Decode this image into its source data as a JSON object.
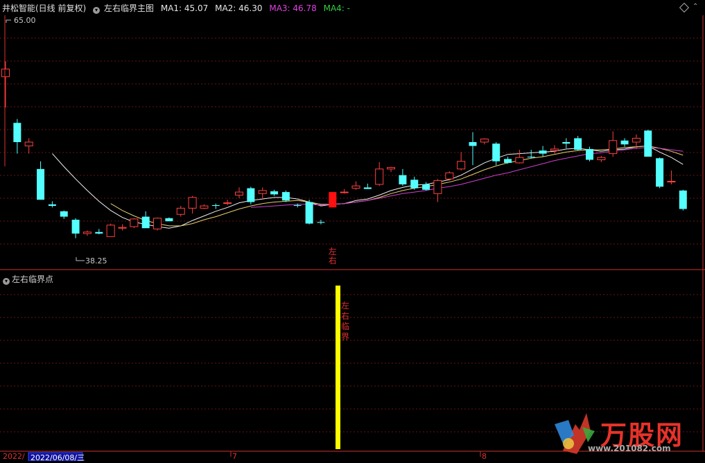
{
  "header": {
    "stock_name": "井松智能(日线 前复权)",
    "indicator_name": "左右临界主图",
    "ma1": "MA1: 45.07",
    "ma2": "MA2: 46.30",
    "ma3": "MA3: 46.78",
    "ma4": "MA4: -",
    "colors": {
      "ma1": "#e6e6e6",
      "ma2": "#e6e6e6",
      "ma3": "#e040e0",
      "ma4": "#30d040"
    }
  },
  "price_labels": {
    "high": "65.00",
    "low": "38.25"
  },
  "signal_label_main": "左右",
  "sub_panel": {
    "title": "左右临界点",
    "signal_label": "左右临界"
  },
  "date_axis": {
    "year_label": "2022/",
    "cursor_date": "2022/06/08/三",
    "month_7": "7",
    "month_8": "8"
  },
  "watermark": {
    "logo_text": "万股网",
    "url": "www.201082.com"
  },
  "chart_data": {
    "type": "candlestick",
    "price_range": [
      35,
      68
    ],
    "candles": [
      [
        60,
        62,
        56,
        61
      ],
      [
        54,
        54.5,
        50,
        51.5
      ],
      [
        51,
        52,
        50,
        51.5
      ],
      [
        48,
        49,
        44,
        44
      ],
      [
        43.4,
        43.8,
        43.0,
        43.2
      ],
      [
        42.5,
        42.6,
        41.5,
        41.8
      ],
      [
        41.4,
        41.6,
        39.0,
        39.6
      ],
      [
        39.6,
        40.0,
        39.3,
        39.8
      ],
      [
        39.8,
        40.2,
        39.5,
        39.6
      ],
      [
        39.2,
        40.9,
        39.2,
        40.7
      ],
      [
        40.3,
        40.8,
        40.0,
        40.4
      ],
      [
        40.5,
        41.6,
        40.3,
        41.5
      ],
      [
        41.8,
        42.5,
        40.8,
        40.3
      ],
      [
        40.2,
        41.7,
        40.0,
        41.6
      ],
      [
        41.6,
        41.7,
        41.2,
        41.2
      ],
      [
        42.1,
        43.2,
        41.8,
        42.9
      ],
      [
        42.9,
        44.5,
        42.2,
        44.3
      ],
      [
        42.9,
        43.4,
        42.8,
        43.2
      ],
      [
        43.3,
        43.5,
        42.8,
        43.2
      ],
      [
        43.6,
        44.0,
        43.3,
        43.6
      ],
      [
        44.6,
        45.6,
        44.2,
        45.0
      ],
      [
        45.5,
        45.7,
        43.4,
        43.7
      ],
      [
        44.8,
        45.6,
        44.1,
        45.2
      ],
      [
        45.1,
        45.3,
        44.5,
        44.7
      ],
      [
        45.0,
        45.2,
        43.7,
        43.9
      ],
      [
        43.3,
        43.5,
        43.0,
        43.2
      ],
      [
        43.7,
        44.0,
        40.8,
        40.9
      ],
      [
        41.1,
        41.4,
        40.8,
        41.0
      ],
      [
        43.0,
        45.0,
        43.0,
        45.0
      ],
      [
        45.0,
        45.4,
        44.8,
        45.0
      ],
      [
        45.5,
        46.4,
        45.3,
        45.8
      ],
      [
        45.6,
        46.1,
        45.4,
        45.4
      ],
      [
        46.0,
        48.9,
        45.8,
        48.0
      ],
      [
        48.0,
        48.3,
        47.6,
        48.2
      ],
      [
        47.2,
        48.0,
        45.8,
        46.0
      ],
      [
        46.6,
        47.0,
        45.3,
        45.5
      ],
      [
        46.0,
        46.3,
        45.2,
        45.3
      ],
      [
        44.8,
        46.7,
        43.7,
        46.5
      ],
      [
        46.7,
        47.7,
        46.5,
        47.5
      ],
      [
        48.0,
        50.2,
        47.8,
        49.0
      ],
      [
        51.5,
        52.8,
        48.5,
        51.0
      ],
      [
        51.5,
        52.0,
        51.2,
        51.9
      ],
      [
        51.3,
        51.5,
        48.5,
        49.0
      ],
      [
        49.3,
        49.6,
        48.7,
        48.8
      ],
      [
        48.8,
        50.5,
        48.7,
        49.5
      ],
      [
        49.6,
        50.5,
        49.4,
        49.5
      ],
      [
        50.4,
        51.0,
        49.6,
        50.0
      ],
      [
        50.4,
        51.1,
        50.0,
        50.6
      ],
      [
        51.5,
        52.0,
        50.7,
        51.3
      ],
      [
        52.0,
        52.3,
        50.4,
        50.5
      ],
      [
        50.6,
        50.9,
        49.0,
        49.2
      ],
      [
        49.2,
        49.7,
        48.9,
        49.5
      ],
      [
        50.0,
        52.9,
        49.6,
        51.7
      ],
      [
        51.7,
        52.0,
        50.9,
        51.2
      ],
      [
        51.5,
        52.5,
        50.6,
        52.0
      ],
      [
        53.0,
        53.1,
        49.6,
        49.6
      ],
      [
        49.4,
        49.5,
        45.5,
        45.7
      ],
      [
        46.4,
        47.8,
        46.0,
        46.4
      ],
      [
        45.2,
        45.3,
        42.6,
        42.8
      ]
    ],
    "ma1": [
      [
        4,
        50
      ],
      [
        5,
        48.3
      ],
      [
        6,
        46.7
      ],
      [
        7,
        45.2
      ],
      [
        8,
        43.8
      ],
      [
        9,
        42.6
      ],
      [
        10,
        41.7
      ],
      [
        11,
        41.1
      ],
      [
        12,
        40.8
      ],
      [
        13,
        40.5
      ],
      [
        14,
        40.3
      ],
      [
        15,
        40.6
      ],
      [
        16,
        41.3
      ],
      [
        17,
        41.9
      ],
      [
        18,
        42.5
      ],
      [
        19,
        43.0
      ],
      [
        20,
        43.6
      ],
      [
        21,
        43.9
      ],
      [
        22,
        44.1
      ],
      [
        23,
        44.3
      ],
      [
        24,
        44.3
      ],
      [
        25,
        44.1
      ],
      [
        26,
        43.7
      ],
      [
        27,
        43.2
      ],
      [
        28,
        43.4
      ],
      [
        29,
        43.5
      ],
      [
        30,
        43.9
      ],
      [
        31,
        44.1
      ],
      [
        32,
        44.6
      ],
      [
        33,
        45.2
      ],
      [
        34,
        45.6
      ],
      [
        35,
        45.9
      ],
      [
        36,
        46.0
      ],
      [
        37,
        46.3
      ],
      [
        38,
        46.6
      ],
      [
        39,
        47.2
      ],
      [
        40,
        48.0
      ],
      [
        41,
        48.8
      ],
      [
        42,
        49.4
      ],
      [
        43,
        49.9
      ],
      [
        44,
        50.0
      ],
      [
        45,
        50.1
      ],
      [
        46,
        50.2
      ],
      [
        47,
        50.3
      ],
      [
        48,
        50.6
      ],
      [
        49,
        50.7
      ],
      [
        50,
        50.5
      ],
      [
        51,
        50.3
      ],
      [
        52,
        50.5
      ],
      [
        53,
        50.6
      ],
      [
        54,
        50.9
      ],
      [
        55,
        51.0
      ],
      [
        56,
        50.2
      ],
      [
        57,
        49.5
      ],
      [
        58,
        48.6
      ]
    ],
    "ma2": [
      [
        9,
        43.5
      ],
      [
        10,
        42.6
      ],
      [
        11,
        41.9
      ],
      [
        12,
        41.3
      ],
      [
        13,
        40.9
      ],
      [
        14,
        40.6
      ],
      [
        15,
        40.6
      ],
      [
        16,
        40.9
      ],
      [
        17,
        41.4
      ],
      [
        18,
        41.8
      ],
      [
        19,
        42.3
      ],
      [
        20,
        42.8
      ],
      [
        21,
        43.2
      ],
      [
        22,
        43.5
      ],
      [
        23,
        43.7
      ],
      [
        24,
        43.8
      ],
      [
        25,
        43.9
      ],
      [
        26,
        43.7
      ],
      [
        27,
        43.4
      ],
      [
        28,
        43.4
      ],
      [
        29,
        43.5
      ],
      [
        30,
        43.7
      ],
      [
        31,
        43.9
      ],
      [
        32,
        44.3
      ],
      [
        33,
        44.8
      ],
      [
        34,
        45.2
      ],
      [
        35,
        45.5
      ],
      [
        36,
        45.7
      ],
      [
        37,
        46.0
      ],
      [
        38,
        46.3
      ],
      [
        39,
        46.7
      ],
      [
        40,
        47.3
      ],
      [
        41,
        47.9
      ],
      [
        42,
        48.4
      ],
      [
        43,
        48.8
      ],
      [
        44,
        49.1
      ],
      [
        45,
        49.4
      ],
      [
        46,
        49.6
      ],
      [
        47,
        49.9
      ],
      [
        48,
        50.2
      ],
      [
        49,
        50.4
      ],
      [
        50,
        50.5
      ],
      [
        51,
        50.5
      ],
      [
        52,
        50.6
      ],
      [
        53,
        50.8
      ],
      [
        54,
        50.9
      ],
      [
        55,
        51.0
      ],
      [
        56,
        50.7
      ],
      [
        57,
        50.3
      ],
      [
        58,
        49.8
      ]
    ],
    "ma3": [
      [
        21,
        43.0
      ],
      [
        22,
        43.1
      ],
      [
        23,
        43.2
      ],
      [
        24,
        43.3
      ],
      [
        25,
        43.4
      ],
      [
        26,
        43.4
      ],
      [
        27,
        43.3
      ],
      [
        28,
        43.4
      ],
      [
        29,
        43.5
      ],
      [
        30,
        43.7
      ],
      [
        31,
        43.9
      ],
      [
        32,
        44.2
      ],
      [
        33,
        44.5
      ],
      [
        34,
        44.8
      ],
      [
        35,
        45.0
      ],
      [
        36,
        45.2
      ],
      [
        37,
        45.5
      ],
      [
        38,
        45.7
      ],
      [
        39,
        46.0
      ],
      [
        40,
        46.4
      ],
      [
        41,
        46.8
      ],
      [
        42,
        47.2
      ],
      [
        43,
        47.5
      ],
      [
        44,
        47.9
      ],
      [
        45,
        48.3
      ],
      [
        46,
        48.7
      ],
      [
        47,
        49.1
      ],
      [
        48,
        49.4
      ],
      [
        49,
        49.7
      ],
      [
        50,
        50.0
      ],
      [
        51,
        50.1
      ],
      [
        52,
        50.3
      ],
      [
        53,
        50.5
      ],
      [
        54,
        50.7
      ],
      [
        55,
        50.8
      ],
      [
        56,
        50.7
      ],
      [
        57,
        50.5
      ],
      [
        58,
        50.3
      ]
    ],
    "signal_index": 28
  }
}
